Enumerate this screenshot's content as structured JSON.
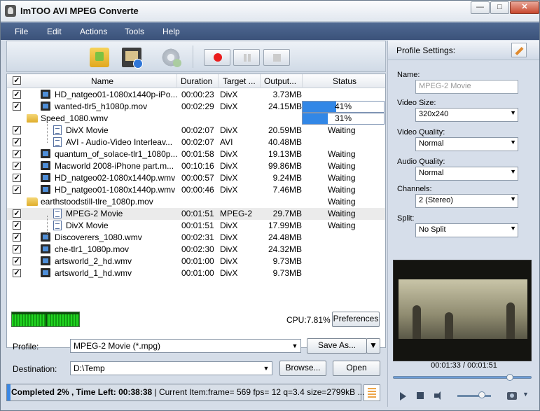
{
  "window": {
    "title": "ImTOO AVI MPEG Converte",
    "min": "—",
    "max": "□",
    "close": "✕"
  },
  "menu": [
    "File",
    "Edit",
    "Actions",
    "Tools",
    "Help"
  ],
  "table": {
    "headers": [
      "Name",
      "Duration",
      "Target ...",
      "Output...",
      "Status"
    ],
    "rows": [
      {
        "type": "file",
        "indent": 0,
        "checked": true,
        "name": "HD_natgeo01-1080x1440p-iPo...",
        "duration": "00:00:23",
        "target": "DivX",
        "output": "3.73MB",
        "status": ""
      },
      {
        "type": "file",
        "indent": 0,
        "checked": true,
        "name": "wanted-tlr5_h1080p.mov",
        "duration": "00:02:29",
        "target": "DivX",
        "output": "24.15MB",
        "status": "41%",
        "progress": 41
      },
      {
        "type": "folder",
        "indent": 0,
        "checked": false,
        "name": "Speed_1080.wmv",
        "duration": "",
        "target": "",
        "output": "",
        "status": "31%",
        "progress": 31
      },
      {
        "type": "profile",
        "indent": 1,
        "checked": true,
        "name": "DivX Movie",
        "duration": "00:02:07",
        "target": "DivX",
        "output": "20.59MB",
        "status": "Waiting"
      },
      {
        "type": "profile",
        "indent": 1,
        "checked": true,
        "name": "AVI - Audio-Video Interleav...",
        "duration": "00:02:07",
        "target": "AVI",
        "output": "40.48MB",
        "status": ""
      },
      {
        "type": "file",
        "indent": 0,
        "checked": true,
        "name": "quantum_of_solace-tlr1_1080p...",
        "duration": "00:01:58",
        "target": "DivX",
        "output": "19.13MB",
        "status": "Waiting"
      },
      {
        "type": "file",
        "indent": 0,
        "checked": true,
        "name": "Macworld 2008-iPhone part.m...",
        "duration": "00:10:16",
        "target": "DivX",
        "output": "99.86MB",
        "status": "Waiting"
      },
      {
        "type": "file",
        "indent": 0,
        "checked": true,
        "name": "HD_natgeo02-1080x1440p.wmv",
        "duration": "00:00:57",
        "target": "DivX",
        "output": "9.24MB",
        "status": "Waiting"
      },
      {
        "type": "file",
        "indent": 0,
        "checked": true,
        "name": "HD_natgeo01-1080x1440p.wmv",
        "duration": "00:00:46",
        "target": "DivX",
        "output": "7.46MB",
        "status": "Waiting"
      },
      {
        "type": "folder",
        "indent": 0,
        "checked": false,
        "name": "earthstoodstill-tlre_1080p.mov",
        "duration": "",
        "target": "",
        "output": "",
        "status": "Waiting"
      },
      {
        "type": "profile",
        "indent": 1,
        "checked": true,
        "selected": true,
        "name": "MPEG-2 Movie",
        "duration": "00:01:51",
        "target": "MPEG-2",
        "output": "29.7MB",
        "status": "Waiting"
      },
      {
        "type": "profile",
        "indent": 1,
        "checked": true,
        "name": "DivX Movie",
        "duration": "00:01:51",
        "target": "DivX",
        "output": "17.99MB",
        "status": "Waiting"
      },
      {
        "type": "file",
        "indent": 0,
        "checked": true,
        "name": "Discoverers_1080.wmv",
        "duration": "00:02:31",
        "target": "DivX",
        "output": "24.48MB",
        "status": ""
      },
      {
        "type": "file",
        "indent": 0,
        "checked": true,
        "name": "che-tlr1_1080p.mov",
        "duration": "00:02:30",
        "target": "DivX",
        "output": "24.32MB",
        "status": ""
      },
      {
        "type": "file",
        "indent": 0,
        "checked": true,
        "name": "artsworld_2_hd.wmv",
        "duration": "00:01:00",
        "target": "DivX",
        "output": "9.73MB",
        "status": ""
      },
      {
        "type": "file",
        "indent": 0,
        "checked": true,
        "name": "artsworld_1_hd.wmv",
        "duration": "00:01:00",
        "target": "DivX",
        "output": "9.73MB",
        "status": ""
      }
    ]
  },
  "cpu": {
    "text": "CPU:7.81%",
    "preferences": "Preferences"
  },
  "profile": {
    "label": "Profile:",
    "value": "MPEG-2 Movie (*.mpg)",
    "save_as": "Save As..."
  },
  "destination": {
    "label": "Destination:",
    "value": "D:\\Temp",
    "browse": "Browse...",
    "open": "Open"
  },
  "status": {
    "completed": "Completed 2% , Time Left: 00:38:38",
    "detail": " | Current Item:frame=  569 fps=  12 q=3.4 size=2799kB ...",
    "progress": 2
  },
  "settings": {
    "title": "Profile Settings:",
    "name_label": "Name:",
    "name_value": "MPEG-2 Movie",
    "fields": [
      {
        "label": "Video Size:",
        "value": "320x240"
      },
      {
        "label": "Video Quality:",
        "value": "Normal"
      },
      {
        "label": "Audio Quality:",
        "value": "Normal"
      },
      {
        "label": "Channels:",
        "value": "2 (Stereo)"
      },
      {
        "label": "Split:",
        "value": "No Split"
      }
    ]
  },
  "player": {
    "timecode": "00:01:33 / 00:01:51",
    "position": 0.84,
    "volume": 0.72
  }
}
